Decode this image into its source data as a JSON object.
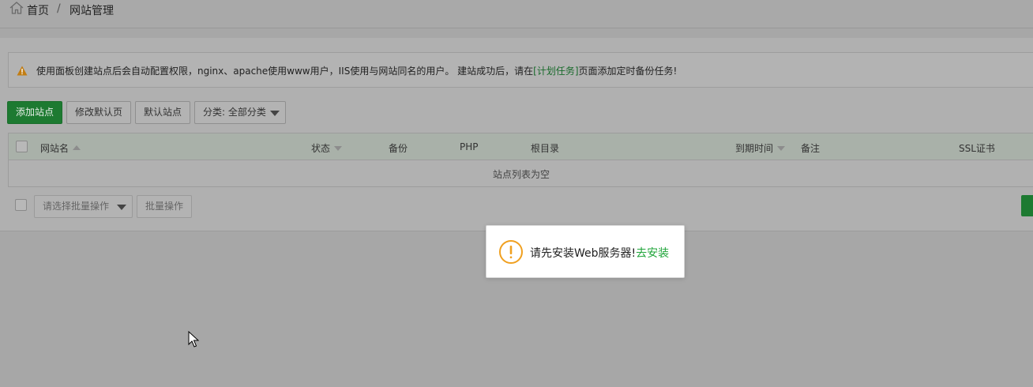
{
  "breadcrumb": {
    "home": "首页",
    "separator": "/",
    "current": "网站管理"
  },
  "notice": {
    "text_before": "使用面板创建站点后会自动配置权限，nginx、apache使用www用户，IIS使用与网站同名的用户。 建站成功后，请在",
    "link": "[计划任务]",
    "text_after": "页面添加定时备份任务!"
  },
  "toolbar": {
    "add_site": "添加站点",
    "edit_default_page": "修改默认页",
    "default_site": "默认站点",
    "category": "分类: 全部分类"
  },
  "table": {
    "columns": {
      "site_name": "网站名",
      "status": "状态",
      "backup": "备份",
      "php": "PHP",
      "root": "根目录",
      "expiry": "到期时间",
      "note": "备注",
      "ssl": "SSL证书"
    },
    "empty_text": "站点列表为空"
  },
  "batch": {
    "select_placeholder": "请选择批量操作",
    "button": "批量操作"
  },
  "dialog": {
    "message": "请先安装Web服务器!",
    "link": "去安装"
  },
  "colors": {
    "primary_green": "#20a53a",
    "warning_orange": "#f0a020"
  }
}
